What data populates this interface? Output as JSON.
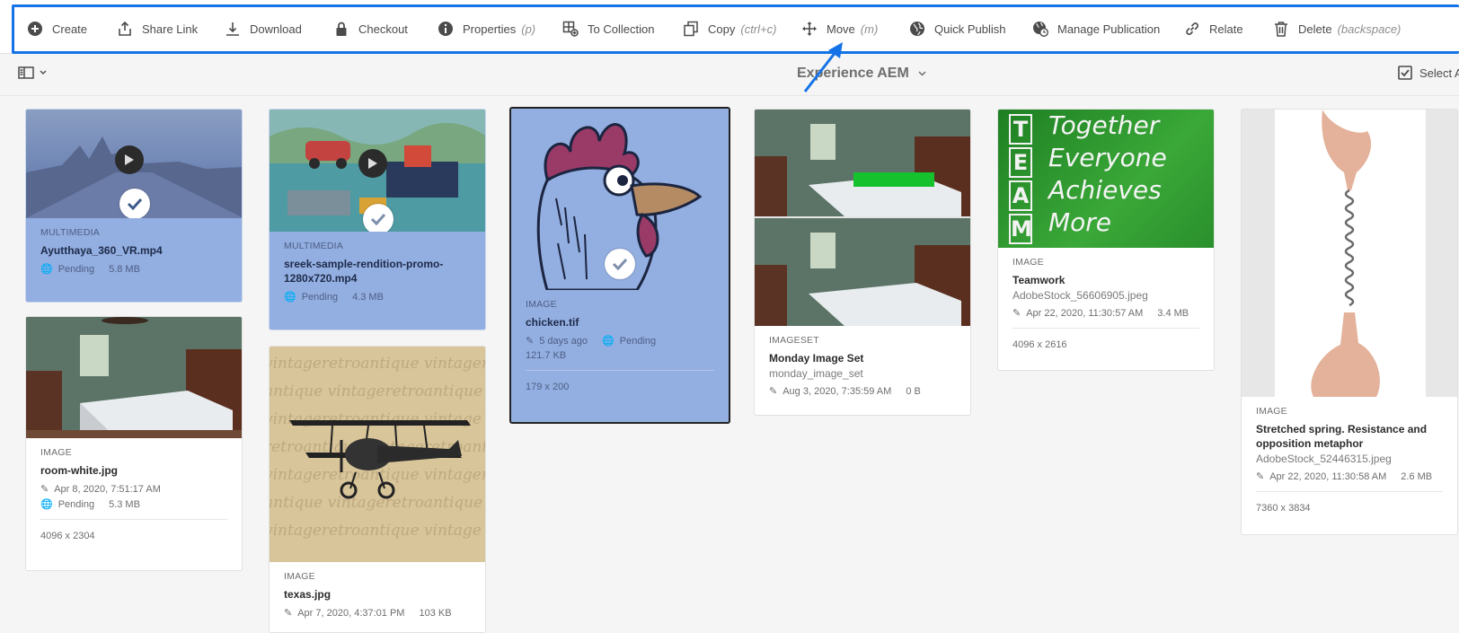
{
  "toolbar": {
    "items": [
      {
        "label": "Create",
        "hint": "",
        "icon": "plus-circle-icon"
      },
      {
        "label": "Share Link",
        "hint": "",
        "icon": "share-icon"
      },
      {
        "label": "Download",
        "hint": "",
        "icon": "download-icon"
      },
      {
        "label": "Checkout",
        "hint": "",
        "icon": "lock-icon"
      },
      {
        "label": "Properties",
        "hint": "(p)",
        "icon": "info-icon"
      },
      {
        "label": "To Collection",
        "hint": "",
        "icon": "collection-add-icon"
      },
      {
        "label": "Copy",
        "hint": "(ctrl+c)",
        "icon": "copy-icon"
      },
      {
        "label": "Move",
        "hint": "(m)",
        "icon": "move-icon"
      },
      {
        "label": "Quick Publish",
        "hint": "",
        "icon": "globe-icon"
      },
      {
        "label": "Manage Publication",
        "hint": "",
        "icon": "globe-clock-icon"
      },
      {
        "label": "Relate",
        "hint": "",
        "icon": "link-icon"
      },
      {
        "label": "Delete",
        "hint": "(backspace)",
        "icon": "trash-icon"
      }
    ],
    "highlight_color": "#1473e6"
  },
  "subbar": {
    "breadcrumb": "Experience AEM",
    "select_all": "Select All"
  },
  "cards": [
    {
      "type": "MULTIMEDIA",
      "title": "Ayutthaya_360_VR.mp4",
      "status": "Pending",
      "size": "5.8 MB",
      "selected": true
    },
    {
      "type": "IMAGE",
      "title": "room-white.jpg",
      "modified": "Apr 8, 2020, 7:51:17 AM",
      "status": "Pending",
      "size": "5.3 MB",
      "dimensions": "4096 x 2304",
      "selected": false
    },
    {
      "type": "MULTIMEDIA",
      "title": "sreek-sample-rendition-promo-1280x720.mp4",
      "status": "Pending",
      "size": "4.3 MB",
      "selected": true
    },
    {
      "type": "IMAGE",
      "title": "texas.jpg",
      "modified": "Apr 7, 2020, 4:37:01 PM",
      "size": "103 KB",
      "selected": false
    },
    {
      "type": "IMAGE",
      "title": "chicken.tif",
      "modified": "5 days ago",
      "status": "Pending",
      "size": "121.7 KB",
      "dimensions": "179 x 200",
      "selected": true
    },
    {
      "type": "IMAGESET",
      "title": "Monday Image Set",
      "subtitle": "monday_image_set",
      "modified": "Aug 3, 2020, 7:35:59 AM",
      "size": "0 B",
      "selected": false
    },
    {
      "type": "IMAGE",
      "title": "Teamwork",
      "subtitle": "AdobeStock_56606905.jpeg",
      "modified": "Apr 22, 2020, 11:30:57 AM",
      "size": "3.4 MB",
      "dimensions": "4096 x 2616",
      "selected": false
    },
    {
      "type": "IMAGE",
      "title": "Stretched spring. Resistance and opposition metaphor",
      "subtitle": "AdobeStock_52446315.jpeg",
      "modified": "Apr 22, 2020, 11:30:58 AM",
      "size": "2.6 MB",
      "dimensions": "7360 x 3834",
      "selected": false
    }
  ],
  "team_board": {
    "letters": [
      "T",
      "E",
      "A",
      "M"
    ],
    "words": [
      "Together",
      "Everyone",
      "Achieves",
      "More"
    ]
  },
  "texas_watermark": [
    "vintageretroantique vintageretr",
    "antique vintageretroantique",
    "vintageretroantique vintage",
    "retroantique vintageretroant",
    "vintageretroantique vintager",
    "antique vintageretroantique",
    "vintageretroantique vintage"
  ]
}
